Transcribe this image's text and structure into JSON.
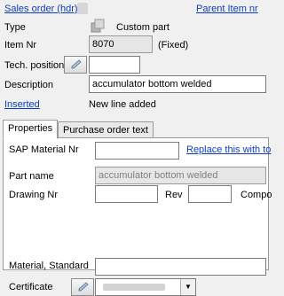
{
  "header": {
    "sales_order_link": "Sales order (hdr)",
    "parent_item_link": "Parent Item nr"
  },
  "form": {
    "type_label": "Type",
    "type_value": "Custom part",
    "item_nr_label": "Item Nr",
    "item_nr_value": "8070",
    "item_nr_note": "(Fixed)",
    "tech_position_label": "Tech. position",
    "tech_position_value": "",
    "description_label": "Description",
    "description_value": "accumulator bottom welded",
    "inserted_link": "Inserted",
    "inserted_status": "New line added"
  },
  "tabs": [
    {
      "label": "Properties",
      "active": true
    },
    {
      "label": "Purchase order text",
      "active": false
    }
  ],
  "properties": {
    "sap_material_label": "SAP Material Nr",
    "sap_material_value": "",
    "replace_link": "Replace this with to",
    "part_name_label": "Part name",
    "part_name_value": "accumulator bottom welded",
    "drawing_nr_label": "Drawing Nr",
    "drawing_nr_value": "",
    "rev_label": "Rev",
    "rev_value": "",
    "compo_label": "Compo",
    "material_standard_label": "Material, Standard",
    "material_standard_value": "",
    "certificate_label": "Certificate"
  },
  "icons": {
    "pencil": "pencil-icon",
    "type": "custom-part-icon",
    "dropdown": "chevron-down-icon"
  }
}
